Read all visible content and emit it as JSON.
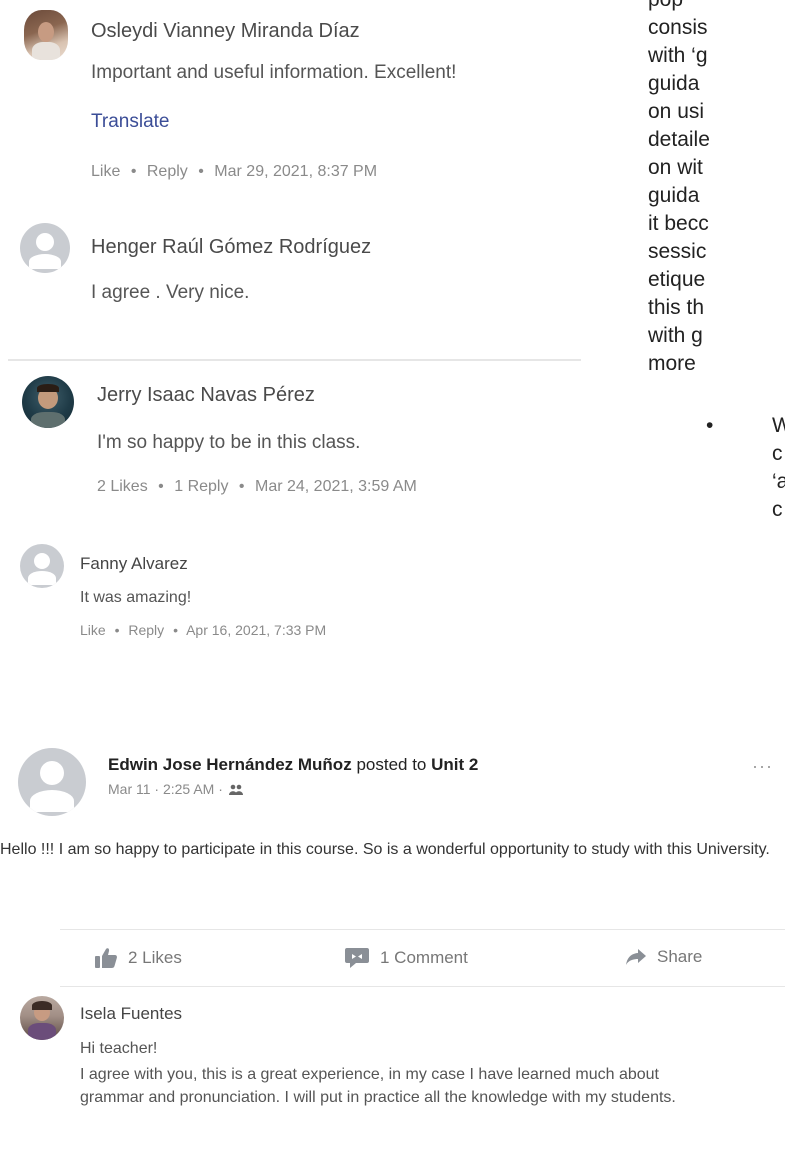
{
  "right_column": {
    "lines": [
      "pop",
      "consis",
      "with ‘g",
      "guida",
      "on usi",
      "detaile",
      "on wit",
      "guida",
      "it becc",
      "sessic",
      "etique",
      "this th",
      "with g",
      "more"
    ],
    "bullet_char": "•",
    "bullet_lines": [
      "W",
      "c",
      "‘a",
      "c"
    ]
  },
  "comments": [
    {
      "author": "Osleydi Vianney Miranda Díaz",
      "text": "Important and useful information. Excellent!",
      "translate_label": "Translate",
      "meta": {
        "like": "Like",
        "sep": "•",
        "reply": "Reply",
        "date": "Mar 29, 2021, 8:37 PM"
      }
    },
    {
      "author": "Henger Raúl Gómez Rodríguez",
      "text": "I agree . Very nice."
    },
    {
      "author": "Jerry Isaac Navas Pérez",
      "text": "I'm so happy to be in this class.",
      "meta": {
        "likes": "2 Likes",
        "sep": "•",
        "replies": "1 Reply",
        "date": "Mar 24, 2021, 3:59 AM"
      }
    },
    {
      "author": "Fanny Alvarez",
      "text": "It was amazing!",
      "meta": {
        "like": "Like",
        "sep": "•",
        "reply": "Reply",
        "date": "Apr 16, 2021, 7:33 PM"
      }
    }
  ],
  "post": {
    "author": "Edwin Jose Hernández Muñoz",
    "posted_to": "posted to",
    "group": "Unit 2",
    "timestamp": "Mar 11 · 2:25 AM ·",
    "more_label": "···",
    "body": "Hello !!! I am so happy to participate in this course. So is a wonderful opportunity to study with this University.",
    "actions": {
      "likes": "2 Likes",
      "comments": "1 Comment",
      "share": "Share"
    }
  },
  "reply": {
    "author": "Isela Fuentes",
    "greeting": "Hi teacher!",
    "text": "I agree with you,  this is a great experience, in my case I have learned much about grammar and pronunciation.  I will put in practice all the knowledge with my students."
  },
  "colors": {
    "link": "#3b4d97",
    "avatar_default": "#c9ccd1",
    "divider": "#e6e6e6"
  }
}
